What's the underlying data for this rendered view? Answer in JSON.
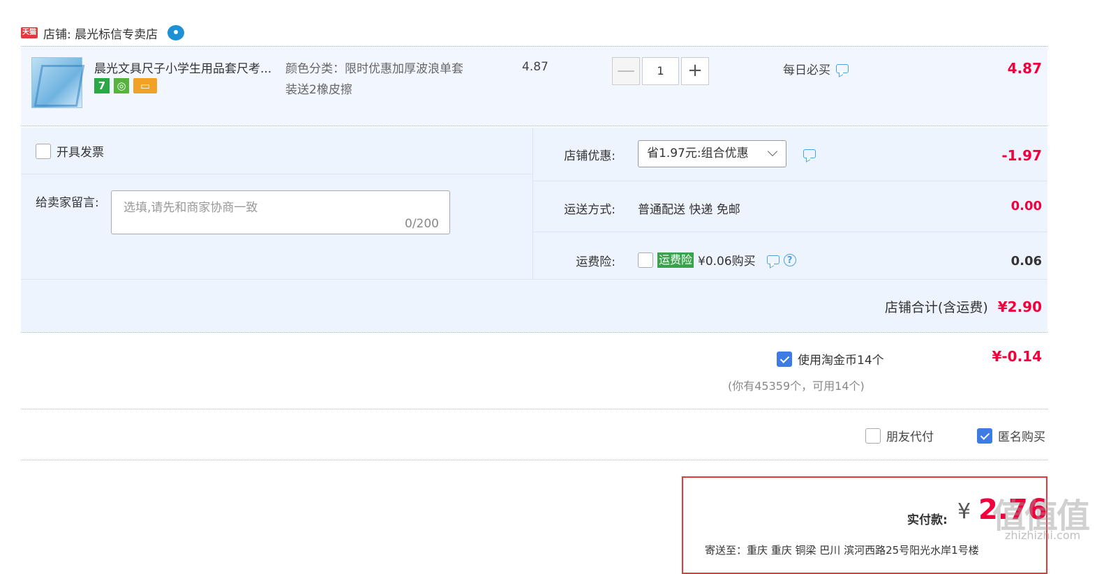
{
  "shop": {
    "tmall_logo": "天猫",
    "label": "店铺:  晨光标信专卖店",
    "contact_icon": "wangwang-icon"
  },
  "item": {
    "title": "晨光文具尺子小学生用品套尺考...",
    "sku_line1": "颜色分类：限时优惠加厚波浪单套",
    "sku_line2": "装送2橡皮擦",
    "unit_price": "4.87",
    "quantity": "1",
    "minus": "—",
    "plus": "+",
    "promo": "每日必买",
    "subtotal": "4.87",
    "badges": [
      "7",
      "◎",
      "▭"
    ]
  },
  "order_options": {
    "invoice_label": "开具发票",
    "message_label": "给卖家留言:",
    "message_placeholder": "选填,请先和商家协商一致",
    "message_count": "0/200",
    "coupon_label": "店铺优惠:",
    "coupon_value": "省1.97元:组合优惠",
    "coupon_discount": "-1.97",
    "shipping_label": "运送方式:",
    "shipping_value": "普通配送 快递 免邮",
    "shipping_cost": "0.00",
    "insurance_label": "运费险:",
    "insurance_tag": "运费险",
    "insurance_text": "¥0.06购买",
    "insurance_cost": "0.06",
    "help": "?",
    "shop_total_label": "店铺合计(含运费)",
    "shop_total_value": "¥2.90"
  },
  "coins": {
    "label": "使用淘金币14个",
    "sub": "(你有45359个，可用14个)",
    "value": "¥-0.14",
    "checked": true
  },
  "extras": {
    "friend_pay": "朋友代付",
    "anonymous": "匿名购买"
  },
  "payment": {
    "label": "实付款:",
    "currency": "¥",
    "value": "2.76",
    "address": "寄送至：重庆 重庆 铜梁 巴川 滨河西路25号阳光水岸1号楼"
  },
  "watermark": {
    "text": "值值值",
    "site": "zhizhizhi.com"
  },
  "colors": {
    "accent_red": "#f2003c",
    "panel_bg": "#eef4fd",
    "checkbox_blue": "#3d7ce5"
  }
}
